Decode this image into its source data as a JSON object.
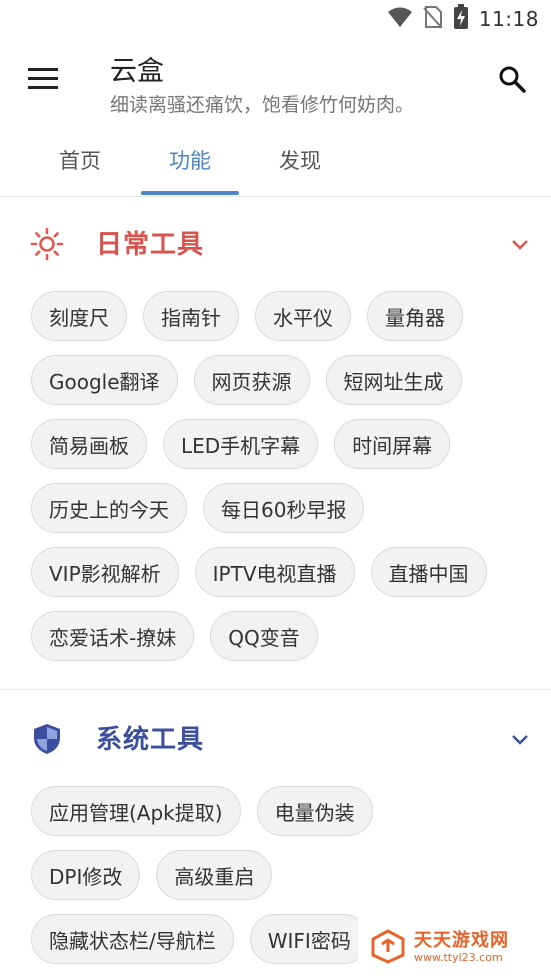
{
  "status": {
    "time": "11:18"
  },
  "app": {
    "title": "云盒",
    "subtitle": "细读离骚还痛饮，饱看修竹何妨肉。"
  },
  "tabs": [
    {
      "label": "首页",
      "active": false
    },
    {
      "label": "功能",
      "active": true
    },
    {
      "label": "发现",
      "active": false
    }
  ],
  "sections": [
    {
      "title": "日常工具",
      "color": "#d9534f",
      "icon": "sun-icon",
      "rows": [
        [
          "刻度尺",
          "指南针",
          "水平仪",
          "量角器"
        ],
        [
          "Google翻译",
          "网页获源",
          "短网址生成"
        ],
        [
          "简易画板",
          "LED手机字幕",
          "时间屏幕"
        ],
        [
          "历史上的今天",
          "每日60秒早报"
        ],
        [
          "VIP影视解析",
          "IPTV电视直播",
          "直播中国"
        ],
        [
          "恋爱话术-撩妹",
          "QQ变音"
        ]
      ]
    },
    {
      "title": "系统工具",
      "color": "#3c4f9e",
      "icon": "shield-icon",
      "rows": [
        [
          "应用管理(Apk提取)",
          "电量伪装"
        ],
        [
          "DPI修改",
          "高级重启"
        ],
        [
          "隐藏状态栏/导航栏",
          "WIFI密码"
        ]
      ]
    }
  ],
  "watermark": {
    "main": "天天游戏网",
    "sub": "www.ttyl23.com"
  },
  "colors": {
    "accent": "#4a84c9",
    "daily": "#d9534f",
    "system": "#3c4f9e"
  }
}
